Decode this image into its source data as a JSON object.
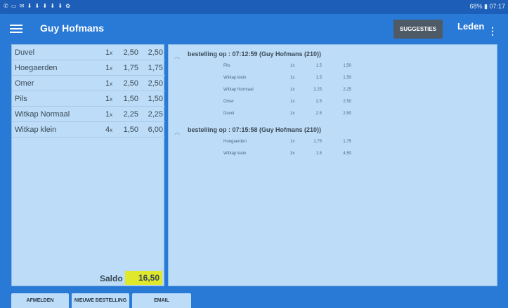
{
  "statusbar": {
    "left_icons": "✆ ▭ ✉ ⬇ ⬇ ⬇ ⬇ ⬇ ✿",
    "right_text": "68% ▮ 07:17"
  },
  "appbar": {
    "title": "Guy Hofmans",
    "suggestions_label": "SUGGESTIES",
    "members_label": "Leden",
    "icons": {
      "menu": "hamburger-menu-icon",
      "more": "more-vert-icon"
    }
  },
  "summary": {
    "items": [
      {
        "name": "Duvel",
        "qty": "1",
        "unit": "x",
        "price": "2,50",
        "total": "2,50"
      },
      {
        "name": "Hoegaerden",
        "qty": "1",
        "unit": "x",
        "price": "1,75",
        "total": "1,75"
      },
      {
        "name": "Omer",
        "qty": "1",
        "unit": "x",
        "price": "2,50",
        "total": "2,50"
      },
      {
        "name": "Pils",
        "qty": "1",
        "unit": "x",
        "price": "1,50",
        "total": "1,50"
      },
      {
        "name": "Witkap Normaal",
        "qty": "1",
        "unit": "x",
        "price": "2,25",
        "total": "2,25"
      },
      {
        "name": "Witkap klein",
        "qty": "4",
        "unit": "x",
        "price": "1,50",
        "total": "6,00"
      }
    ],
    "saldo_label": "Saldo",
    "saldo_value": "16,50"
  },
  "orders": [
    {
      "heading": "bestelling op : 07:12:59 (Guy Hofmans (210))",
      "lines": [
        {
          "name": "Pils",
          "qty": "1x",
          "price": "1.5",
          "total": "1,50"
        },
        {
          "name": "Witkap klein",
          "qty": "1x",
          "price": "1.5",
          "total": "1,50"
        },
        {
          "name": "Witkap Normaal",
          "qty": "1x",
          "price": "2.25",
          "total": "2,25"
        },
        {
          "name": "Omer",
          "qty": "1x",
          "price": "2.5",
          "total": "2,50"
        },
        {
          "name": "Duvel",
          "qty": "1x",
          "price": "2.5",
          "total": "2,50"
        }
      ]
    },
    {
      "heading": "bestelling op : 07:15:58 (Guy Hofmans (210))",
      "lines": [
        {
          "name": "Hoegaerden",
          "qty": "1x",
          "price": "1.75",
          "total": "1,75"
        },
        {
          "name": "Witkap klein",
          "qty": "3x",
          "price": "1.5",
          "total": "4,50"
        }
      ]
    }
  ],
  "bottombar": {
    "logout_label": "AFMELDEN",
    "new_order_label": "NIEUWE BESTELLING",
    "email_label": "EMAIL"
  },
  "colors": {
    "accent": "#2979d6",
    "panel": "#bcdcf7",
    "saldo_highlight": "#dfe82b",
    "suggest_button": "#4e5a66"
  }
}
